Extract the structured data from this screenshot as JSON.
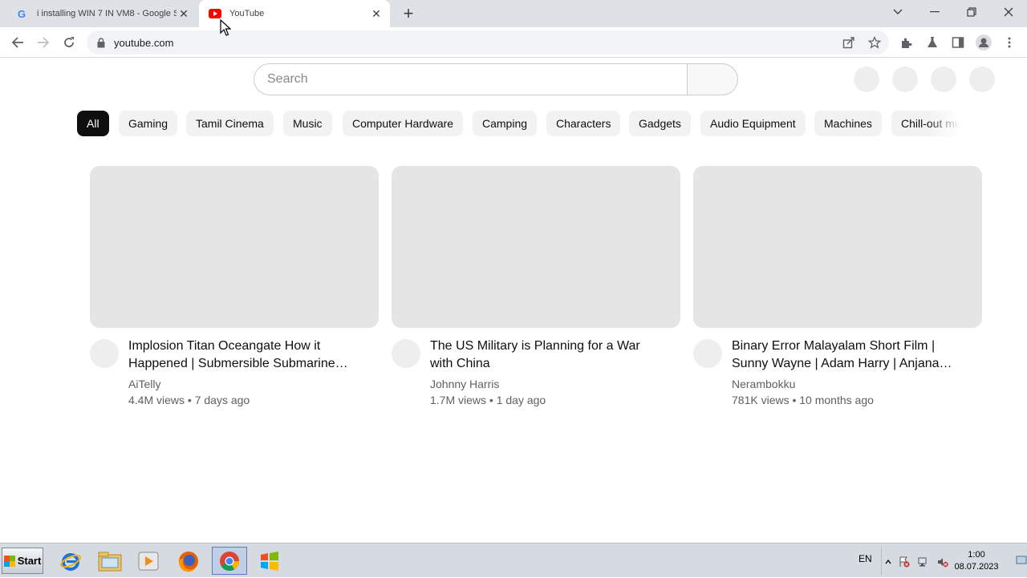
{
  "browser": {
    "tabs": [
      {
        "title": "i installing WIN 7 IN VM8 - Google S",
        "favicon": "google-icon",
        "active": false
      },
      {
        "title": "YouTube",
        "favicon": "youtube-icon",
        "active": true
      }
    ],
    "address": "youtube.com"
  },
  "youtube": {
    "search_placeholder": "Search",
    "chips": [
      "All",
      "Gaming",
      "Tamil Cinema",
      "Music",
      "Computer Hardware",
      "Camping",
      "Characters",
      "Gadgets",
      "Audio Equipment",
      "Machines",
      "Chill-out mu"
    ],
    "selected_chip": "All",
    "videos": [
      {
        "title": "Implosion Titan Oceangate How it Happened | Submersible Submarine…",
        "channel": "AiTelly",
        "stats": "4.4M views • 7 days ago"
      },
      {
        "title": "The US Military is Planning for a War with China",
        "channel": "Johnny Harris",
        "stats": "1.7M views • 1 day ago"
      },
      {
        "title": "Binary Error Malayalam Short Film | Sunny Wayne | Adam Harry | Anjana…",
        "channel": "Nerambokku",
        "stats": "781K views • 10 months ago"
      }
    ]
  },
  "taskbar": {
    "start_label": "Start",
    "language": "EN",
    "time": "1:00",
    "date": "08.07.2023"
  }
}
